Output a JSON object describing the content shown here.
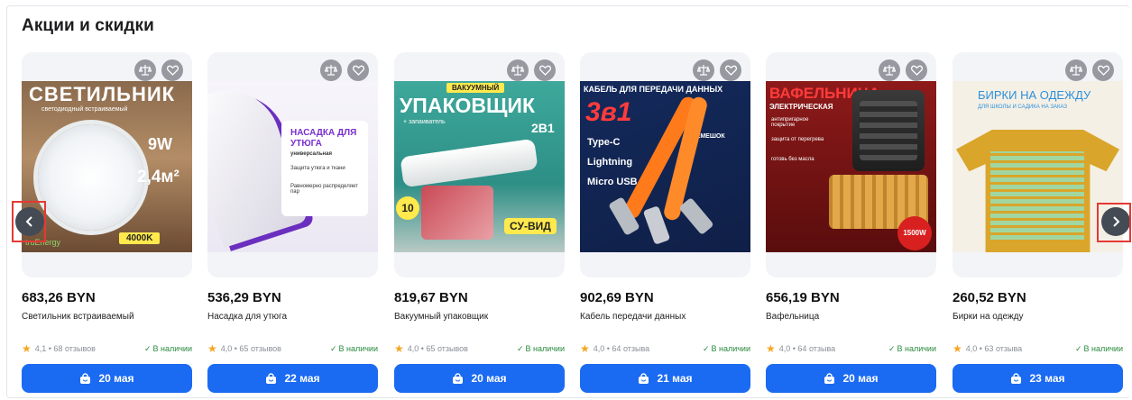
{
  "section": {
    "title": "Акции и скидки"
  },
  "colors": {
    "accent": "#1b6af2",
    "in_stock": "#2a8a3e",
    "star": "#f5a623",
    "highlight": "#e53935"
  },
  "icons": {
    "compare": "scales-icon",
    "favorite": "heart-icon",
    "delivery": "shopping-bag-icon",
    "prev": "chevron-left-icon",
    "next": "chevron-right-icon"
  },
  "products": [
    {
      "price": "683,26 BYN",
      "name": "Светильник встраиваемый",
      "rating": "4,1 • 68 отзывов",
      "stock": "В наличии",
      "delivery": "20 мая",
      "photo_text": {
        "headline": "СВЕТИЛЬНИК",
        "sub": "светодиодный встраиваемый",
        "power": "9W",
        "area": "2,4м²",
        "temp": "4000K",
        "brand": "truEnergy"
      }
    },
    {
      "price": "536,29 BYN",
      "name": "Насадка для утюга",
      "rating": "4,0 • 65 отзывов",
      "stock": "В наличии",
      "delivery": "22 мая",
      "photo_text": {
        "headline": "НАСАДКА ДЛЯ УТЮГА",
        "sub": "универсальная",
        "feat1": "Защита утюга и ткани",
        "feat2": "Равномерно распределяет пар"
      }
    },
    {
      "price": "819,67 BYN",
      "name": "Вакуумный упаковщик",
      "rating": "4,0 • 65 отзывов",
      "stock": "В наличии",
      "delivery": "20 мая",
      "photo_text": {
        "badge": "ВАКУУМНЫЙ",
        "headline": "УПАКОВЩИК",
        "sub": "+ запаиватель",
        "combo": "2В1",
        "mode": "СУ-ВИД",
        "count": "10"
      }
    },
    {
      "price": "902,69 BYN",
      "name": "Кабель передачи данных",
      "rating": "4,0 • 64 отзыва",
      "stock": "В наличии",
      "delivery": "21 мая",
      "photo_text": {
        "headline": "КАБЕЛЬ ДЛЯ ПЕРЕДАЧИ ДАННЫХ",
        "big": "3в1",
        "t1": "Type-C",
        "t2": "Lightning",
        "t3": "Micro USB",
        "strap": "РЕМЕШОК"
      }
    },
    {
      "price": "656,19 BYN",
      "name": "Вафельница",
      "rating": "4,0 • 64 отзыва",
      "stock": "В наличии",
      "delivery": "20 мая",
      "photo_text": {
        "headline": "ВАФЕЛЬНИЦА",
        "sub": "ЭЛЕКТРИЧЕСКАЯ",
        "f1": "антипригарное покрытие",
        "f2": "защита от перегрева",
        "f3": "готовь без масла",
        "power": "1500W"
      }
    },
    {
      "price": "260,52 BYN",
      "name": "Бирки на одежду",
      "rating": "4,0 • 63 отзыва",
      "stock": "В наличии",
      "delivery": "23 мая",
      "photo_text": {
        "headline": "БИРКИ НА ОДЕЖДУ",
        "sub": "ДЛЯ ШКОЛЫ И САДИКА НА ЗАКАЗ"
      }
    }
  ]
}
